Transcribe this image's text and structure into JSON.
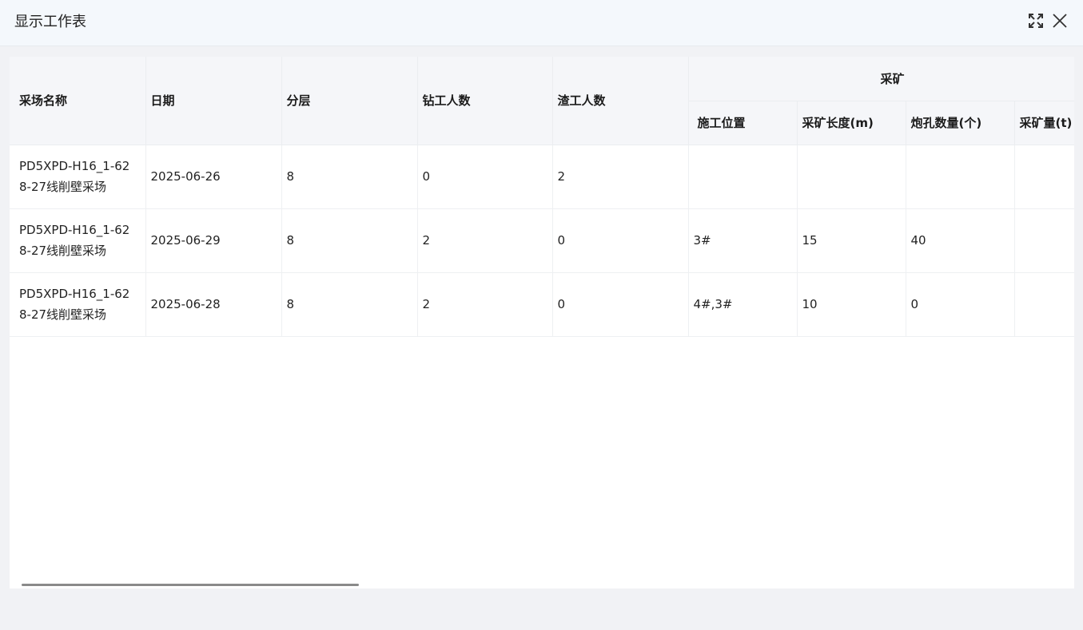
{
  "dialog": {
    "title": "显示工作表"
  },
  "icons": {
    "maximize": "expand-arrows-icon",
    "close": "close-x-icon"
  },
  "table": {
    "columns": {
      "stope_name": "采场名称",
      "date": "日期",
      "layer": "分层",
      "drillers": "钻工人数",
      "muckers": "渣工人数",
      "mining_group": "采矿",
      "position": "施工位置",
      "length": "采矿长度(m)",
      "holes": "炮孔数量(个)",
      "tonnage": "采矿量(t)"
    },
    "rows": [
      {
        "stope_name": "PD5XPD-H16_1-628-27线削壁采场",
        "date": "2025-06-26",
        "layer": "8",
        "drillers": "0",
        "muckers": "2",
        "position": "",
        "length": "",
        "holes": "",
        "tonnage": ""
      },
      {
        "stope_name": "PD5XPD-H16_1-628-27线削壁采场",
        "date": "2025-06-29",
        "layer": "8",
        "drillers": "2",
        "muckers": "0",
        "position": "3#",
        "length": "15",
        "holes": "40",
        "tonnage": ""
      },
      {
        "stope_name": "PD5XPD-H16_1-628-27线削壁采场",
        "date": "2025-06-28",
        "layer": "8",
        "drillers": "2",
        "muckers": "0",
        "position": "4#,3#",
        "length": "10",
        "holes": "0",
        "tonnage": ""
      }
    ]
  }
}
